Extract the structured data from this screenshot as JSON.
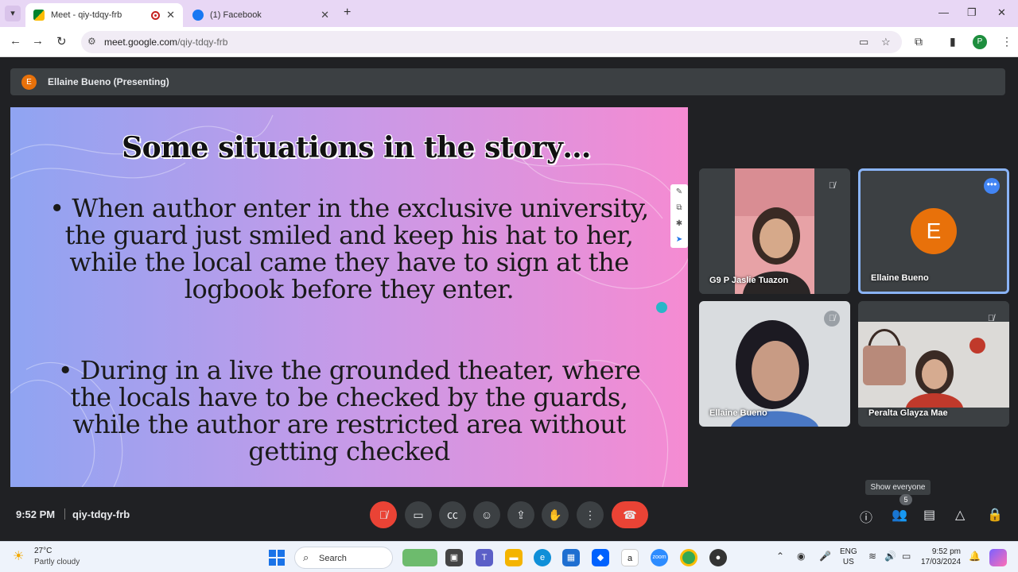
{
  "browser": {
    "tabs": [
      {
        "title": "Meet - qiy-tdqy-frb",
        "active": true
      },
      {
        "title": "(1) Facebook",
        "active": false
      }
    ],
    "new_tab_icon": "+",
    "url_domain": "meet.google.com",
    "url_path": "/qiy-tdqy-frb",
    "profile_initial": "P",
    "window_controls": {
      "minimize": "—",
      "restore": "❐",
      "close": "✕"
    }
  },
  "meet": {
    "presenter": {
      "initial": "E",
      "label": "Ellaine Bueno (Presenting)"
    },
    "slide": {
      "title": "Some situations in the story…",
      "bullets": [
        "•  When author enter in the exclusive university,  the guard just smiled and keep his hat to her, while the local came they have to sign at the logbook before they enter.",
        "•  During in a live the grounded theater, where the locals have to be checked by the guards, while the author are restricted area without getting checked"
      ]
    },
    "participants": [
      {
        "name": "G9 P Jaslie Tuazon",
        "muted": true
      },
      {
        "name": "Ellaine Bueno",
        "initial": "E",
        "muted": false
      },
      {
        "name": "Ellaine Bueno",
        "muted": true
      },
      {
        "name": "Peralta Glayza Mae",
        "muted": true
      }
    ],
    "bottom_bar": {
      "time": "9:52 PM",
      "meeting_code": "qiy-tdqy-frb",
      "tooltip": "Show everyone",
      "people_count": "5"
    }
  },
  "taskbar": {
    "weather_temp": "27°C",
    "weather_desc": "Partly cloudy",
    "search_placeholder": "Search",
    "lang_line1": "ENG",
    "lang_line2": "US",
    "clock_time": "9:52 pm",
    "clock_date": "17/03/2024"
  },
  "colors": {
    "meet_bg": "#202124",
    "end_call": "#ea4335",
    "avatar_orange": "#e8710a",
    "active_speaker_border": "#8ab4f8"
  }
}
